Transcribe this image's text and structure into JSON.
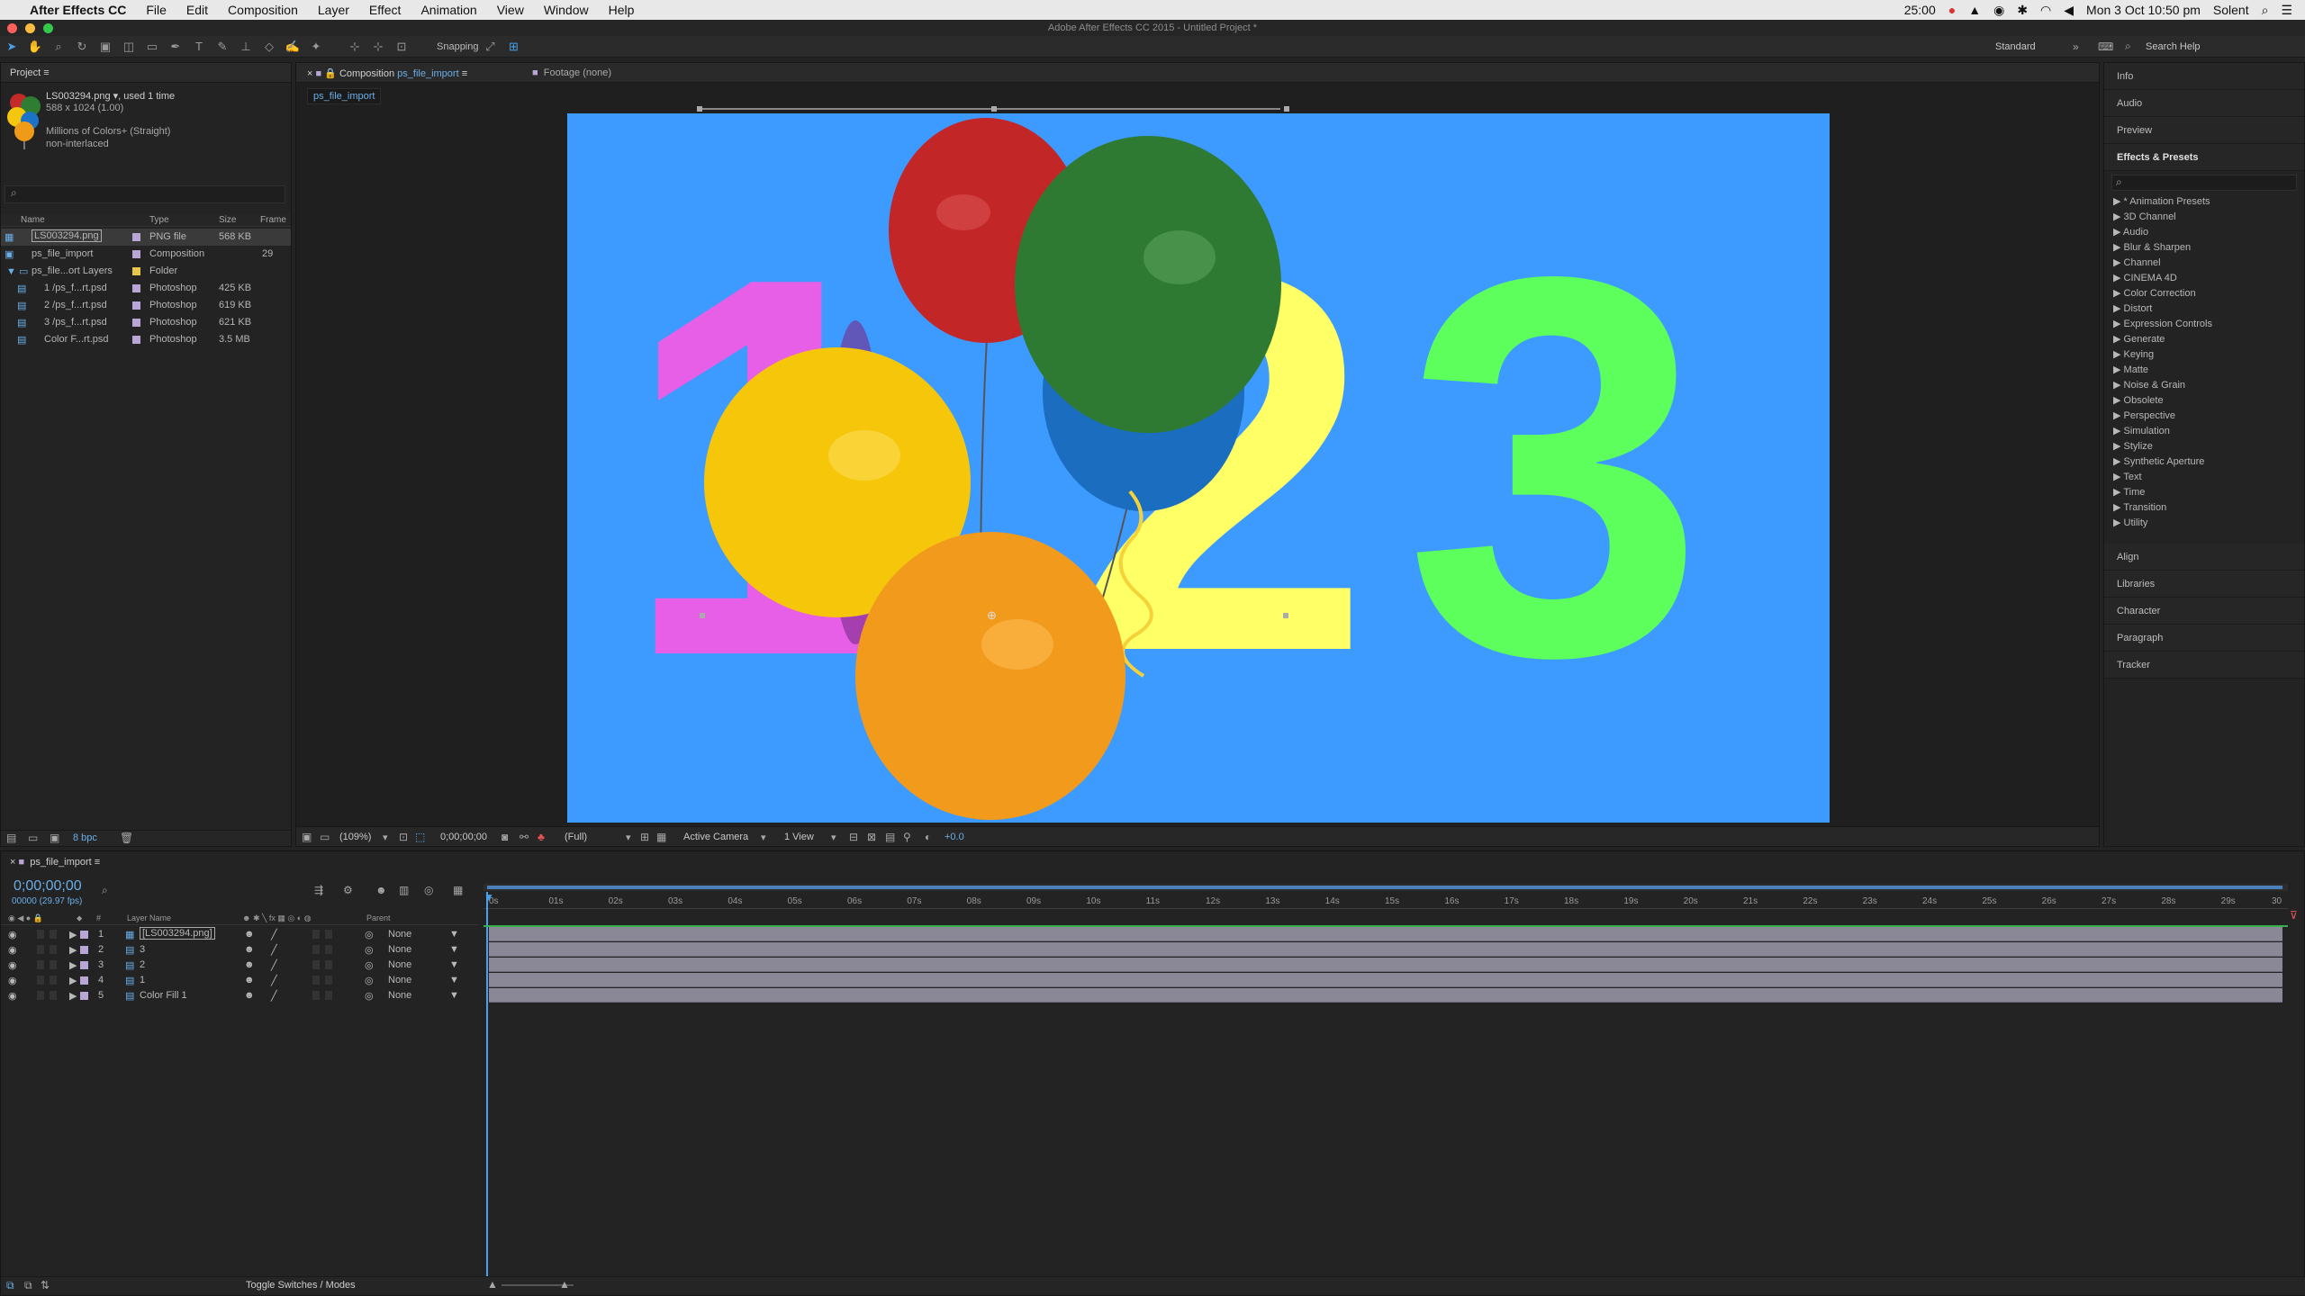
{
  "menubar": {
    "apple": "",
    "app_name": "After Effects CC",
    "items": [
      "File",
      "Edit",
      "Composition",
      "Layer",
      "Effect",
      "Animation",
      "View",
      "Window",
      "Help"
    ],
    "clock_fps": "25:00",
    "datetime": "Mon 3 Oct 10:50 pm",
    "user": "Solent"
  },
  "window_title": "Adobe After Effects CC 2015 - Untitled Project *",
  "toolbar": {
    "snapping_label": "Snapping",
    "workspace": "Standard",
    "search_placeholder": "Search Help"
  },
  "project": {
    "title": "Project",
    "selected_file": "LS003294.png ▾",
    "used_text": ", used 1 time",
    "dimensions": "588 x 1024 (1.00)",
    "color_info": "Millions of Colors+ (Straight)",
    "interlace": "non-interlaced",
    "columns": [
      "Name",
      "Type",
      "Size",
      "Frame"
    ],
    "items": [
      {
        "name": "LS003294.png",
        "type": "PNG file",
        "size": "568 KB",
        "frame": "",
        "color": "#b8a6d6"
      },
      {
        "name": "ps_file_import",
        "type": "Composition",
        "size": "",
        "frame": "29",
        "color": "#b8a6d6"
      },
      {
        "name": "ps_file...ort Layers",
        "type": "Folder",
        "size": "",
        "frame": "",
        "color": "#e8c64a"
      },
      {
        "name": "1 /ps_f...rt.psd",
        "type": "Photoshop",
        "size": "425 KB",
        "frame": "",
        "color": "#b8a6d6"
      },
      {
        "name": "2 /ps_f...rt.psd",
        "type": "Photoshop",
        "size": "619 KB",
        "frame": "",
        "color": "#b8a6d6"
      },
      {
        "name": "3 /ps_f...rt.psd",
        "type": "Photoshop",
        "size": "621 KB",
        "frame": "",
        "color": "#b8a6d6"
      },
      {
        "name": "Color F...rt.psd",
        "type": "Photoshop",
        "size": "3.5 MB",
        "frame": "",
        "color": "#b8a6d6"
      }
    ],
    "bpc": "8 bpc"
  },
  "viewer": {
    "tab_comp_prefix": "Composition",
    "tab_comp_name": "ps_file_import",
    "tab_footage": "Footage (none)",
    "comp_flowchart_tab": "ps_file_import",
    "zoom": "(109%)",
    "timecode": "0;00;00;00",
    "resolution": "(Full)",
    "camera": "Active Camera",
    "views": "1 View",
    "exposure": "+0.0",
    "canvas_bg": "#3d9bff",
    "digit_1": "1",
    "digit_2": "2",
    "digit_3": "3"
  },
  "right_panels": {
    "info": "Info",
    "audio": "Audio",
    "preview": "Preview",
    "effects_title": "Effects & Presets",
    "effects": [
      "* Animation Presets",
      "3D Channel",
      "Audio",
      "Blur & Sharpen",
      "Channel",
      "CINEMA 4D",
      "Color Correction",
      "Distort",
      "Expression Controls",
      "Generate",
      "Keying",
      "Matte",
      "Noise & Grain",
      "Obsolete",
      "Perspective",
      "Simulation",
      "Stylize",
      "Synthetic Aperture",
      "Text",
      "Time",
      "Transition",
      "Utility"
    ],
    "align": "Align",
    "libraries": "Libraries",
    "character": "Character",
    "paragraph": "Paragraph",
    "tracker": "Tracker"
  },
  "timeline": {
    "comp_name": "ps_file_import",
    "timecode": "0;00;00;00",
    "fps_info": "00000 (29.97 fps)",
    "col_hash": "#",
    "col_layer_name": "Layer Name",
    "col_parent": "Parent",
    "layers": [
      {
        "num": "1",
        "name": "[LS003294.png]",
        "parent": "None"
      },
      {
        "num": "2",
        "name": "3",
        "parent": "None"
      },
      {
        "num": "3",
        "name": "2",
        "parent": "None"
      },
      {
        "num": "4",
        "name": "1",
        "parent": "None"
      },
      {
        "num": "5",
        "name": "Color Fill 1",
        "parent": "None"
      }
    ],
    "ruler": [
      "0s",
      "01s",
      "02s",
      "03s",
      "04s",
      "05s",
      "06s",
      "07s",
      "08s",
      "09s",
      "10s",
      "11s",
      "12s",
      "13s",
      "14s",
      "15s",
      "16s",
      "17s",
      "18s",
      "19s",
      "20s",
      "21s",
      "22s",
      "23s",
      "24s",
      "25s",
      "26s",
      "27s",
      "28s",
      "29s",
      "30"
    ],
    "toggle_label": "Toggle Switches / Modes"
  }
}
